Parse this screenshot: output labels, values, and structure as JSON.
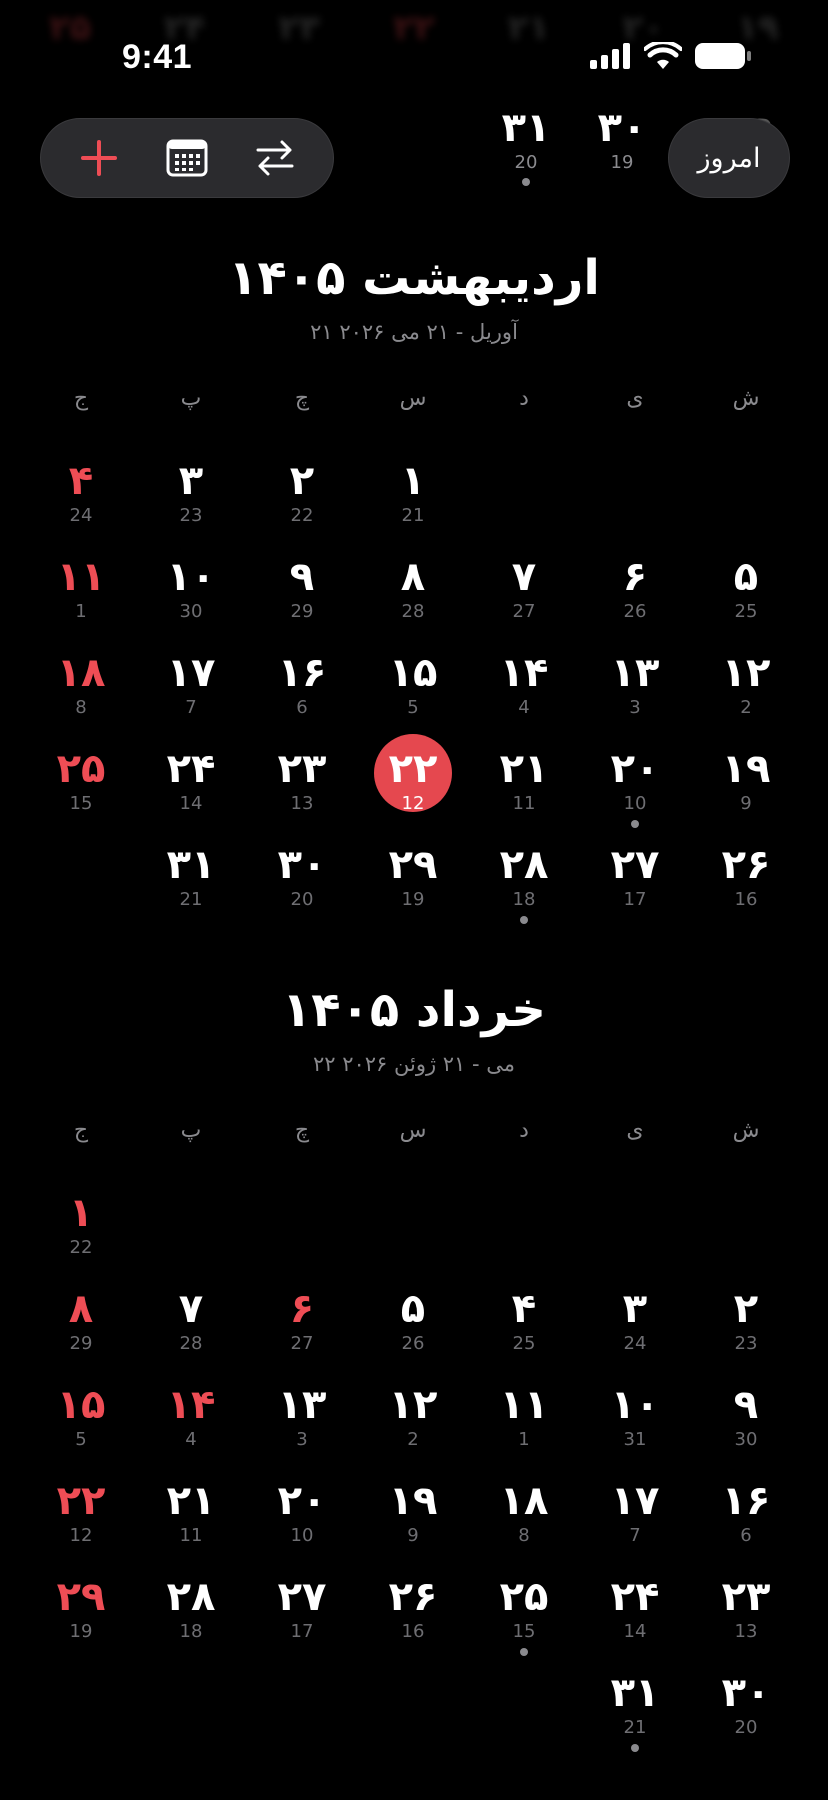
{
  "status_bar": {
    "time": "9:41",
    "icons": [
      "signal-icon",
      "wifi-icon",
      "battery-icon"
    ]
  },
  "ghost_row": {
    "days": [
      "۲۵",
      "۲۴",
      "۲۳",
      "۲۲",
      "۲۱",
      "۲۰",
      "۱۹"
    ]
  },
  "toolbar": {
    "add_icon": "plus-icon",
    "calendar_icon": "calendar-grid-icon",
    "switch_icon": "swap-arrows-icon"
  },
  "today_button": {
    "label": "امروز"
  },
  "week_strip": [
    {
      "fa": "۳۱",
      "gr": "20",
      "dot": true
    },
    {
      "fa": "۳۰",
      "gr": "19",
      "dot": false
    }
  ],
  "week_strip_peek": "۲۹",
  "weekdays": [
    "ش",
    "ی",
    "د",
    "س",
    "چ",
    "پ",
    "ج"
  ],
  "colors": {
    "accent": "#e5484f",
    "holiday": "#ee4d55",
    "secondary": "#8a8a8e",
    "background": "#000000"
  },
  "months": [
    {
      "title": "اردیبهشت ۱۴۰۵",
      "subtitle": "۲۱ آوریل - ۲۱ می ۲۰۲۶",
      "weeks": [
        [
          null,
          null,
          null,
          {
            "fa": "۱",
            "gr": "21"
          },
          {
            "fa": "۲",
            "gr": "22"
          },
          {
            "fa": "۳",
            "gr": "23"
          },
          {
            "fa": "۴",
            "gr": "24",
            "holiday": true
          }
        ],
        [
          {
            "fa": "۵",
            "gr": "25"
          },
          {
            "fa": "۶",
            "gr": "26"
          },
          {
            "fa": "۷",
            "gr": "27"
          },
          {
            "fa": "۸",
            "gr": "28"
          },
          {
            "fa": "۹",
            "gr": "29"
          },
          {
            "fa": "۱۰",
            "gr": "30"
          },
          {
            "fa": "۱۱",
            "gr": "1",
            "holiday": true
          }
        ],
        [
          {
            "fa": "۱۲",
            "gr": "2"
          },
          {
            "fa": "۱۳",
            "gr": "3"
          },
          {
            "fa": "۱۴",
            "gr": "4"
          },
          {
            "fa": "۱۵",
            "gr": "5"
          },
          {
            "fa": "۱۶",
            "gr": "6"
          },
          {
            "fa": "۱۷",
            "gr": "7"
          },
          {
            "fa": "۱۸",
            "gr": "8",
            "holiday": true
          }
        ],
        [
          {
            "fa": "۱۹",
            "gr": "9"
          },
          {
            "fa": "۲۰",
            "gr": "10",
            "dot": true
          },
          {
            "fa": "۲۱",
            "gr": "11"
          },
          {
            "fa": "۲۲",
            "gr": "12",
            "today": true
          },
          {
            "fa": "۲۳",
            "gr": "13"
          },
          {
            "fa": "۲۴",
            "gr": "14"
          },
          {
            "fa": "۲۵",
            "gr": "15",
            "holiday": true
          }
        ],
        [
          {
            "fa": "۲۶",
            "gr": "16"
          },
          {
            "fa": "۲۷",
            "gr": "17"
          },
          {
            "fa": "۲۸",
            "gr": "18",
            "dot": true
          },
          {
            "fa": "۲۹",
            "gr": "19"
          },
          {
            "fa": "۳۰",
            "gr": "20"
          },
          {
            "fa": "۳۱",
            "gr": "21"
          },
          null
        ]
      ]
    },
    {
      "title": "خرداد ۱۴۰۵",
      "subtitle": "۲۲ می - ۲۱ ژوئن ۲۰۲۶",
      "weeks": [
        [
          null,
          null,
          null,
          null,
          null,
          null,
          {
            "fa": "۱",
            "gr": "22",
            "holiday": true
          }
        ],
        [
          {
            "fa": "۲",
            "gr": "23"
          },
          {
            "fa": "۳",
            "gr": "24"
          },
          {
            "fa": "۴",
            "gr": "25"
          },
          {
            "fa": "۵",
            "gr": "26"
          },
          {
            "fa": "۶",
            "gr": "27",
            "holiday": true
          },
          {
            "fa": "۷",
            "gr": "28"
          },
          {
            "fa": "۸",
            "gr": "29",
            "holiday": true
          }
        ],
        [
          {
            "fa": "۹",
            "gr": "30"
          },
          {
            "fa": "۱۰",
            "gr": "31"
          },
          {
            "fa": "۱۱",
            "gr": "1"
          },
          {
            "fa": "۱۲",
            "gr": "2"
          },
          {
            "fa": "۱۳",
            "gr": "3"
          },
          {
            "fa": "۱۴",
            "gr": "4",
            "holiday": true
          },
          {
            "fa": "۱۵",
            "gr": "5",
            "holiday": true
          }
        ],
        [
          {
            "fa": "۱۶",
            "gr": "6"
          },
          {
            "fa": "۱۷",
            "gr": "7"
          },
          {
            "fa": "۱۸",
            "gr": "8"
          },
          {
            "fa": "۱۹",
            "gr": "9"
          },
          {
            "fa": "۲۰",
            "gr": "10"
          },
          {
            "fa": "۲۱",
            "gr": "11"
          },
          {
            "fa": "۲۲",
            "gr": "12",
            "holiday": true
          }
        ],
        [
          {
            "fa": "۲۳",
            "gr": "13"
          },
          {
            "fa": "۲۴",
            "gr": "14"
          },
          {
            "fa": "۲۵",
            "gr": "15",
            "dot": true
          },
          {
            "fa": "۲۶",
            "gr": "16"
          },
          {
            "fa": "۲۷",
            "gr": "17"
          },
          {
            "fa": "۲۸",
            "gr": "18"
          },
          {
            "fa": "۲۹",
            "gr": "19",
            "holiday": true
          }
        ],
        [
          {
            "fa": "۳۰",
            "gr": "20"
          },
          {
            "fa": "۳۱",
            "gr": "21",
            "dot": true
          },
          null,
          null,
          null,
          null,
          null
        ]
      ]
    }
  ]
}
